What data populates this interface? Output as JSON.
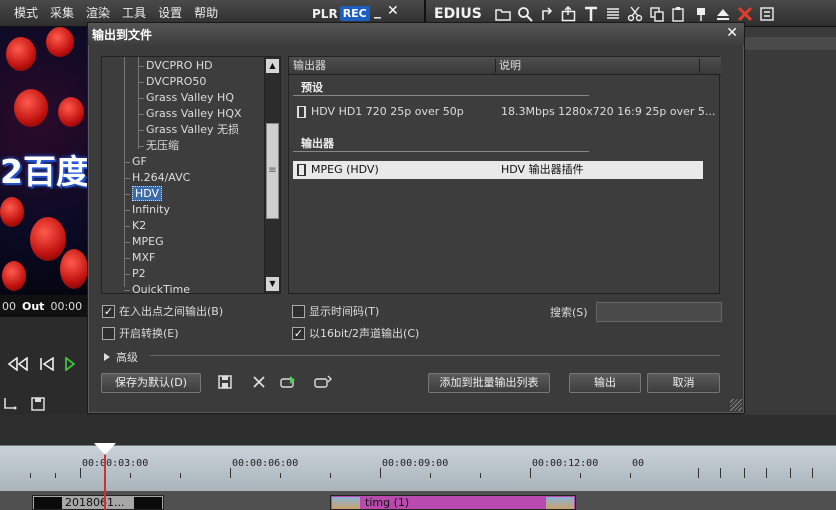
{
  "menubar": {
    "items": [
      "模式",
      "采集",
      "渲染",
      "工具",
      "设置",
      "帮助"
    ],
    "plr": "PLR",
    "rec": "REC",
    "minimize": "_",
    "close": "✕",
    "edius_title": "EDIUS"
  },
  "preview": {
    "overlay_text": "2百度",
    "tc_left": "00",
    "out_label": "Out",
    "out_tc": "00:00"
  },
  "dialog": {
    "title": "输出到文件",
    "close": "✕",
    "tree": {
      "items": [
        {
          "label": "DVCPRO HD",
          "level": 2
        },
        {
          "label": "DVCPRO50",
          "level": 2
        },
        {
          "label": "Grass Valley HQ",
          "level": 2
        },
        {
          "label": "Grass Valley HQX",
          "level": 2
        },
        {
          "label": "Grass Valley 无损",
          "level": 2
        },
        {
          "label": "无压缩",
          "level": 2
        },
        {
          "label": "GF",
          "level": 1
        },
        {
          "label": "H.264/AVC",
          "level": 1
        },
        {
          "label": "HDV",
          "level": 1,
          "selected": true
        },
        {
          "label": "Infinity",
          "level": 1
        },
        {
          "label": "K2",
          "level": 1
        },
        {
          "label": "MPEG",
          "level": 1
        },
        {
          "label": "MXF",
          "level": 1
        },
        {
          "label": "P2",
          "level": 1
        },
        {
          "label": "QuickTime",
          "level": 1
        }
      ]
    },
    "list": {
      "col_exporter": "输出器",
      "col_desc": "说明",
      "section_preset": "预设",
      "preset_rows": [
        {
          "name": "HDV HD1 720 25p over 50p",
          "desc": "18.3Mbps 1280x720 16:9 25p over 5..."
        }
      ],
      "section_exporter": "输出器",
      "exporter_rows": [
        {
          "name": "MPEG (HDV)",
          "desc": "HDV 输出器插件",
          "selected": true
        }
      ]
    },
    "options": {
      "export_in_out": {
        "label": "在入出点之间输出(B)",
        "checked": true
      },
      "show_timecode": {
        "label": "显示时间码(T)",
        "checked": false
      },
      "enable_convert": {
        "label": "开启转换(E)",
        "checked": false
      },
      "export_16bit": {
        "label": "以16bit/2声道输出(C)",
        "checked": true
      }
    },
    "search": {
      "label": "搜索(S)",
      "value": ""
    },
    "advanced": "高级",
    "buttons": {
      "save_default": "保存为默认(D)",
      "add_batch": "添加到批量输出列表",
      "export": "输出",
      "cancel": "取消"
    }
  },
  "timeline": {
    "labels": [
      "00:00:03:00",
      "00:00:06:00",
      "00:00:09:00",
      "00:00:12:00",
      "00"
    ],
    "clip1": "2018061...",
    "clip2": "timg (1)"
  }
}
